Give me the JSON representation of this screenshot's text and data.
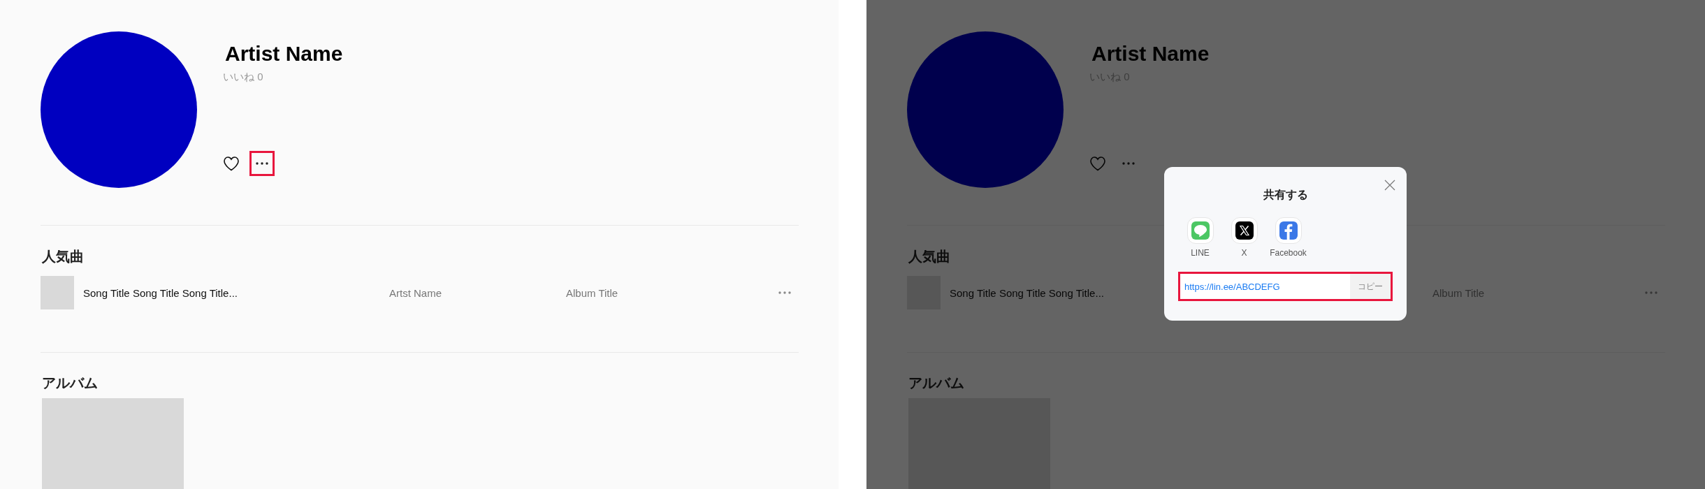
{
  "screens": [
    {
      "artist": {
        "name": "Artist Name",
        "likes": "いいね 0"
      },
      "more_highlighted": true,
      "popular": {
        "title": "人気曲",
        "rows": [
          {
            "title": "Song Title Song Title Song Title...",
            "artist": "Artst Name",
            "album": "Album Title"
          }
        ]
      },
      "albums": {
        "title": "アルバム"
      }
    },
    {
      "artist": {
        "name": "Artist Name",
        "likes": "いいね 0"
      },
      "more_highlighted": false,
      "popular": {
        "title": "人気曲",
        "rows": [
          {
            "title": "Song Title Song Title Song Title...",
            "album": "Album Title"
          }
        ]
      },
      "albums": {
        "title": "アルバム"
      },
      "modal": {
        "title": "共有する",
        "services": [
          {
            "kind": "line",
            "label": "LINE"
          },
          {
            "kind": "x",
            "label": "X"
          },
          {
            "kind": "facebook",
            "label": "Facebook"
          }
        ],
        "url": "https://lin.ee/ABCDEFG",
        "copy": "コピー",
        "url_highlighted": true
      }
    }
  ]
}
